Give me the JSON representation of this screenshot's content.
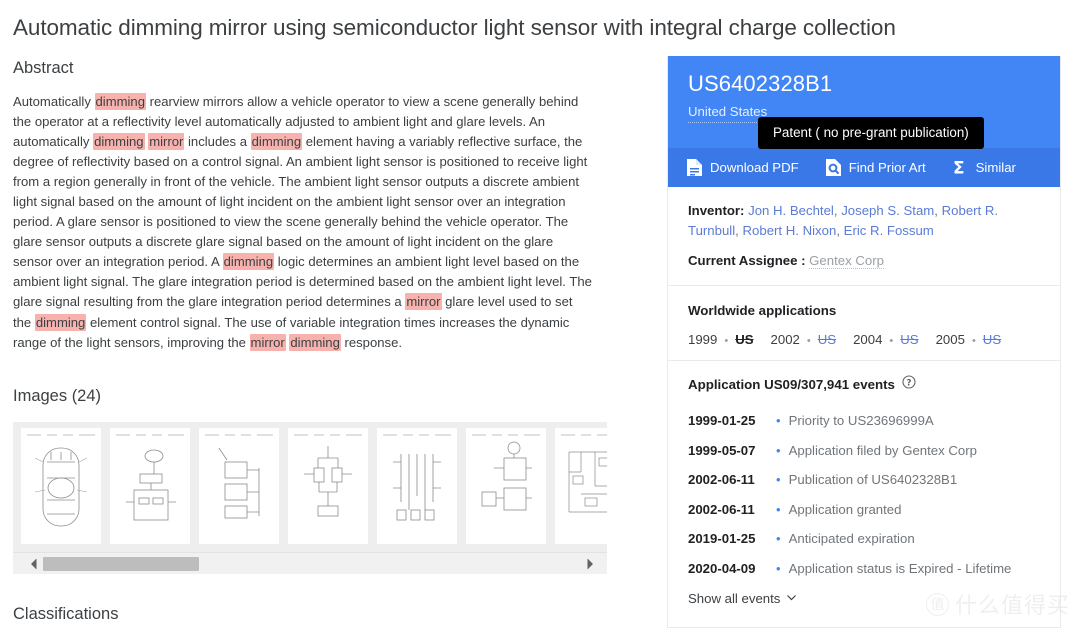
{
  "page_title": "Automatic dimming mirror using semiconductor light sensor with integral charge collection",
  "sections": {
    "abstract_heading": "Abstract",
    "images_heading": "Images (24)",
    "classifications_heading": "Classifications"
  },
  "abstract": {
    "highlight_color": "#f7b2ad",
    "tokens": [
      {
        "t": "Automatically ",
        "h": false
      },
      {
        "t": "dimming",
        "h": true
      },
      {
        "t": " rearview mirrors allow a vehicle operator to view a scene generally behind the operator at a reflectivity level automatically adjusted to ambient light and glare levels. An automatically ",
        "h": false
      },
      {
        "t": "dimming",
        "h": true
      },
      {
        "t": " ",
        "h": false
      },
      {
        "t": "mirror",
        "h": true
      },
      {
        "t": " includes a ",
        "h": false
      },
      {
        "t": "dimming",
        "h": true
      },
      {
        "t": " element having a variably reflective surface, the degree of reflectivity based on a control signal. An ambient light sensor is positioned to receive light from a region generally in front of the vehicle. The ambient light sensor outputs a discrete ambient light signal based on the amount of light incident on the ambient light sensor over an integration period. A glare sensor is positioned to view the scene generally behind the vehicle operator. The glare sensor outputs a discrete glare signal based on the amount of light incident on the glare sensor over an integration period. A ",
        "h": false
      },
      {
        "t": "dimming",
        "h": true
      },
      {
        "t": " logic determines an ambient light level based on the ambient light signal. The glare integration period is determined based on the ambient light level. The glare signal resulting from the glare integration period determines a ",
        "h": false
      },
      {
        "t": "mirror",
        "h": true
      },
      {
        "t": " glare level used to set the ",
        "h": false
      },
      {
        "t": "dimming",
        "h": true
      },
      {
        "t": " element control signal. The use of variable integration times increases the dynamic range of the light sensors, improving the ",
        "h": false
      },
      {
        "t": "mirror",
        "h": true
      },
      {
        "t": " ",
        "h": false
      },
      {
        "t": "dimming",
        "h": true
      },
      {
        "t": " response.",
        "h": false
      }
    ]
  },
  "carousel": {
    "thumbnail_count": 7,
    "scrollbar_left_arrow_icon": "chevron-left-icon",
    "scrollbar_right_arrow_icon": "chevron-right-icon"
  },
  "patent_card": {
    "header_color": "#4285f4",
    "action_bar_color": "#3b78e7",
    "publication_number": "US6402328B1",
    "country": "United States",
    "tooltip": "Patent ( no pre-grant publication)",
    "actions": [
      {
        "label": "Download PDF",
        "icon": "document-download-icon"
      },
      {
        "label": "Find Prior Art",
        "icon": "prior-art-search-icon"
      },
      {
        "label": "Similar",
        "icon": "sigma-similar-icon"
      }
    ],
    "inventor_label": "Inventor:",
    "inventors": [
      "Jon H. Bechtel",
      "Joseph S. Stam",
      "Robert R. Turnbull",
      "Robert H. Nixon",
      "Eric R. Fossum"
    ],
    "assignee_label": "Current Assignee :",
    "assignee": "Gentex Corp",
    "worldwide": {
      "title": "Worldwide applications",
      "entries": [
        {
          "year": "1999",
          "country": "US",
          "active": true
        },
        {
          "year": "2002",
          "country": "US",
          "active": false
        },
        {
          "year": "2004",
          "country": "US",
          "active": false
        },
        {
          "year": "2005",
          "country": "US",
          "active": false
        }
      ]
    },
    "events": {
      "title": "Application US09/307,941 events",
      "help_icon": "help-circle-icon",
      "rows": [
        {
          "date": "1999-01-25",
          "text": "Priority to US23696999A"
        },
        {
          "date": "1999-05-07",
          "text": "Application filed by Gentex Corp"
        },
        {
          "date": "2002-06-11",
          "text": "Publication of US6402328B1"
        },
        {
          "date": "2002-06-11",
          "text": "Application granted"
        },
        {
          "date": "2019-01-25",
          "text": "Anticipated expiration"
        },
        {
          "date": "2020-04-09",
          "text": "Application status is Expired - Lifetime"
        }
      ],
      "show_all_label": "Show all events",
      "show_all_icon": "chevron-down-icon"
    }
  },
  "watermark": {
    "mark": "值",
    "text": "什么值得买"
  }
}
